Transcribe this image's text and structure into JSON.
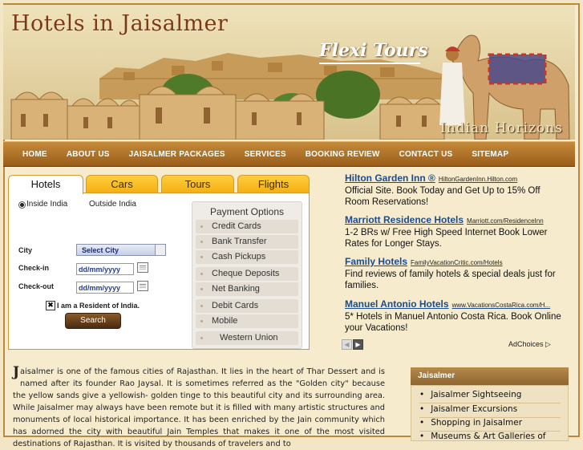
{
  "header": {
    "title": "Hotels in Jaisalmer",
    "brand": "Flexi Tours",
    "tagline": "Indian Horizons"
  },
  "nav": [
    "HOME",
    "ABOUT US",
    "JAISALMER PACKAGES",
    "SERVICES",
    "BOOKING REVIEW",
    "CONTACT US",
    "SITEMAP"
  ],
  "booking": {
    "tabs": [
      "Hotels",
      "Cars",
      "Tours",
      "Flights"
    ],
    "active_tab": "Hotels",
    "radio_inside": "Inside India",
    "radio_outside": "Outside India",
    "city_label": "City",
    "city_value": "Select City",
    "checkin_label": "Check-in",
    "checkin_value": "dd/mm/yyyy",
    "checkout_label": "Check-out",
    "checkout_value": "dd/mm/yyyy",
    "resident_label": "I am a Resident of India.",
    "resident_mark": "✖",
    "search_label": "Search"
  },
  "payment": {
    "title": "Payment Options",
    "items": [
      "Credit Cards",
      "Bank Transfer",
      "Cash Pickups",
      "Cheque Deposits",
      "Net Banking",
      "Debit Cards",
      "Mobile",
      "Western Union"
    ]
  },
  "ads": [
    {
      "title": "Hilton Garden Inn ®",
      "url": "HiltonGardenInn.Hilton.com",
      "text": "Official Site. Book Today and Get Up to 15% Off Room Reservations!"
    },
    {
      "title": "Marriott Residence Hotels",
      "url": "Marriott.com/ResidenceInn",
      "text": "1-2 BRs w/ Free High Speed Internet Book Lower Rates for Longer Stays."
    },
    {
      "title": "Family Hotels",
      "url": "FamilyVacationCritic.com/Hotels",
      "text": "Find reviews of family hotels & special deals just for families."
    },
    {
      "title": "Manuel Antonio Hotels",
      "url": "www.VacationsCostaRica.com/H...",
      "text": "5* Hotels in Manuel Antonio Costa Rica. Book Online your Vacations!"
    }
  ],
  "adchoices": "AdChoices ▷",
  "content": {
    "dropcap": "J",
    "text": "aisalmer is one of the famous cities of Rajasthan. It lies in the heart of Thar Dessert and is named after its founder Rao Jaysal. It is sometimes referred as the \"Golden city\" because the yellow sands give a yellowish- golden tinge to this beautiful city and its surrounding area. While Jaisalmer may always have been remote but it is filled with many artistic structures and monuments of local historical importance. It has been enriched by the Jain community which has adorned the city with beautiful Jain Temples that makes it one of the most visited destinations of Rajasthan. It is visited by thousands of travelers and to"
  },
  "sidebar": {
    "heading": "Jaisalmer",
    "items": [
      "Jaisalmer Sightseeing",
      "Jaisalmer Excursions",
      "Shopping in Jaisalmer",
      "Museums & Art Galleries of"
    ]
  },
  "colors": {
    "nav_bg": "#b37a2e",
    "tab_bg": "#f7b81f",
    "link": "#1a4c8f",
    "header_title": "#7a3a16"
  }
}
